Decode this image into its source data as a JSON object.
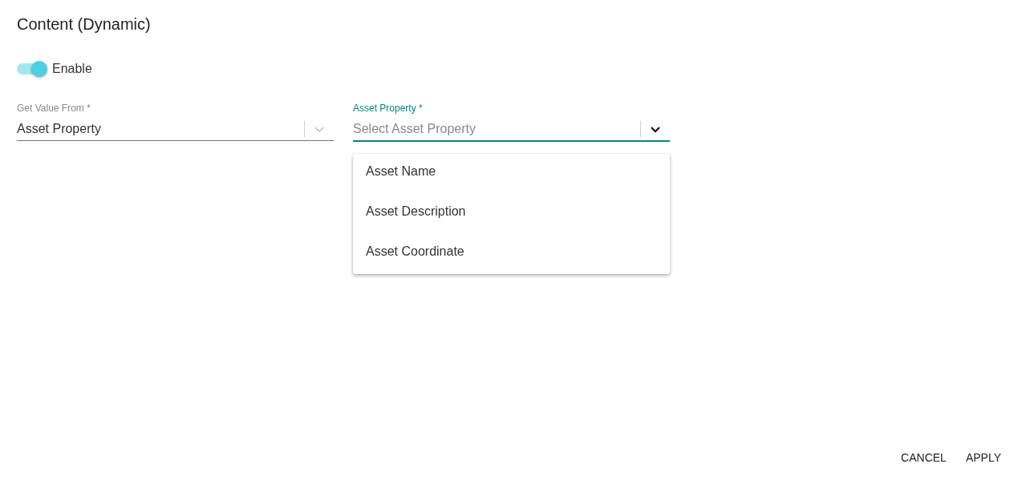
{
  "title": "Content (Dynamic)",
  "toggle": {
    "label": "Enable",
    "on": true
  },
  "fields": [
    {
      "label": "Get Value From *",
      "value": "Asset Property",
      "focused": false
    },
    {
      "label": "Asset Property *",
      "placeholder": "Select Asset Property",
      "focused": true,
      "open": true,
      "options": [
        "Asset Name",
        "Asset Description",
        "Asset Coordinate"
      ]
    }
  ],
  "buttons": [
    "CANCEL",
    "APPLY"
  ]
}
